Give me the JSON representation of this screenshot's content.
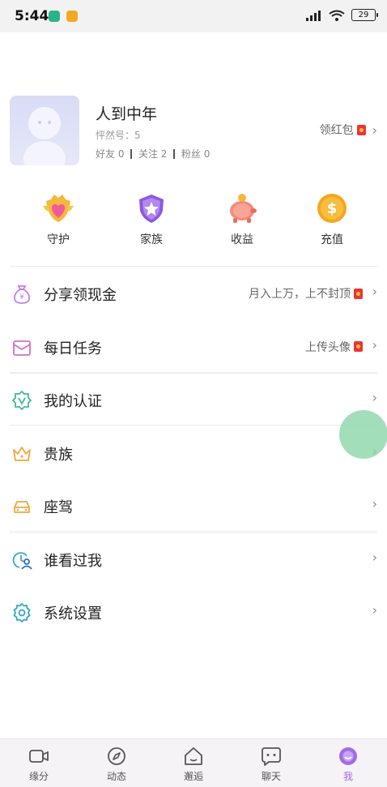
{
  "status_bar": {
    "time": "5:44",
    "battery": "29"
  },
  "profile": {
    "name": "人到中年",
    "id_line": "怦然号：5",
    "stats": [
      "好友 0",
      "关注 2",
      "粉丝 0"
    ],
    "redpacket_label": "领红包"
  },
  "quick_actions": [
    {
      "label": "守护",
      "icon": "guard-icon"
    },
    {
      "label": "家族",
      "icon": "family-shield-icon"
    },
    {
      "label": "收益",
      "icon": "piggy-bank-icon"
    },
    {
      "label": "充值",
      "icon": "coin-icon"
    }
  ],
  "menu": [
    {
      "label": "分享领现金",
      "sub": "月入上万，上不封顶",
      "icon": "money-bag-icon",
      "badge": true
    },
    {
      "label": "每日任务",
      "sub": "上传头像",
      "icon": "task-envelope-icon",
      "badge": true
    },
    {
      "label": "我的认证",
      "sub": "",
      "icon": "verified-badge-icon",
      "badge": false
    },
    {
      "label": "贵族",
      "sub": "",
      "icon": "crown-icon",
      "badge": false
    },
    {
      "label": "座驾",
      "sub": "",
      "icon": "car-icon",
      "badge": false
    },
    {
      "label": "谁看过我",
      "sub": "",
      "icon": "visitor-clock-icon",
      "badge": false
    },
    {
      "label": "系统设置",
      "sub": "",
      "icon": "settings-gear-icon",
      "badge": false
    }
  ],
  "tabs": [
    {
      "label": "缘分",
      "icon": "video-icon",
      "active": false
    },
    {
      "label": "动态",
      "icon": "compass-icon",
      "active": false
    },
    {
      "label": "邂逅",
      "icon": "home-icon",
      "active": false
    },
    {
      "label": "聊天",
      "icon": "chat-bubble-icon",
      "active": false
    },
    {
      "label": "我",
      "icon": "me-face-icon",
      "active": true
    }
  ],
  "colors": {
    "accent": "#a36be8",
    "red": "#e33333",
    "bubble": "#8cd6aa"
  }
}
